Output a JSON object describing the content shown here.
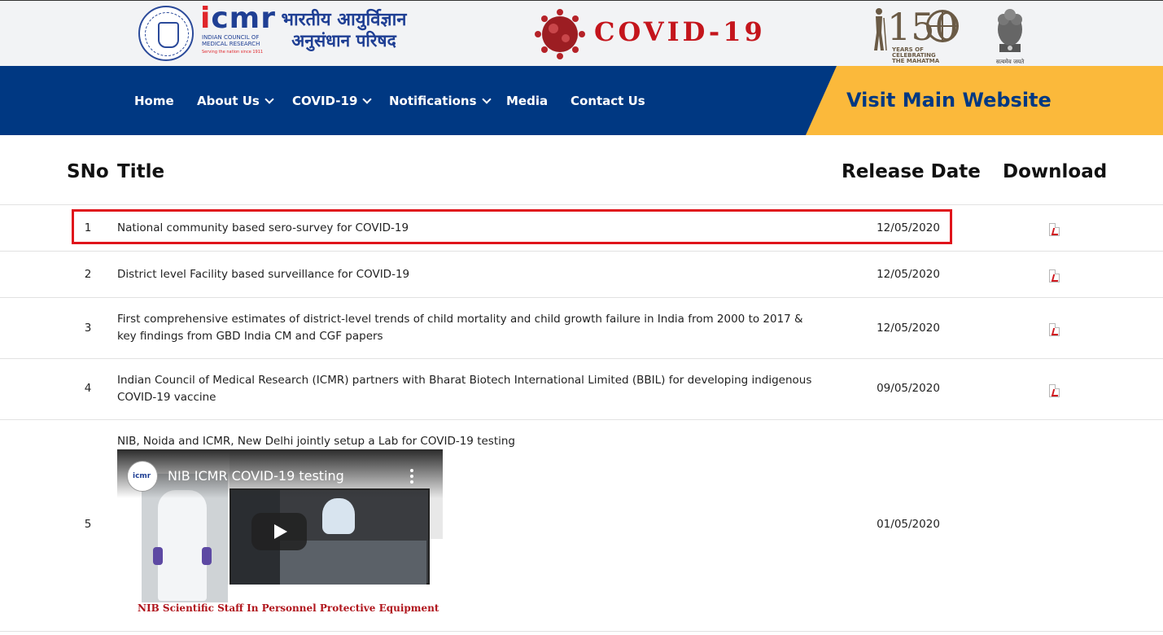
{
  "header": {
    "icmr_logo_text": "icmr",
    "icmr_full_name": "INDIAN COUNCIL OF MEDICAL RESEARCH",
    "icmr_tagline": "Serving the nation since 1911",
    "hindi_line1": "भारतीय आयुर्विज्ञान",
    "hindi_line2": "अनुसंधान परिषद",
    "covid_title": "COVID-19",
    "logo150_number": "150",
    "logo150_caption_lines": [
      "YEARS OF",
      "CELEBRATING",
      "THE MAHATMA"
    ],
    "emblem_caption": "सत्यमेव जयते"
  },
  "nav": {
    "items": [
      {
        "label": "Home",
        "dropdown": false
      },
      {
        "label": "About Us",
        "dropdown": true
      },
      {
        "label": "COVID-19",
        "dropdown": true
      },
      {
        "label": "Notifications",
        "dropdown": true
      },
      {
        "label": "Media",
        "dropdown": false
      },
      {
        "label": "Contact Us",
        "dropdown": false
      }
    ],
    "visit_label": "Visit Main Website"
  },
  "table": {
    "headers": {
      "sno": "SNo",
      "title": "Title",
      "release_date": "Release Date",
      "download": "Download"
    },
    "rows": [
      {
        "sno": "1",
        "title": "National community based sero-survey for COVID-19",
        "date": "12/05/2020",
        "has_pdf": true
      },
      {
        "sno": "2",
        "title": "District level Facility based surveillance for COVID-19",
        "date": "12/05/2020",
        "has_pdf": true
      },
      {
        "sno": "3",
        "title": "First comprehensive estimates of district-level trends of child mortality and child growth failure in India from 2000 to 2017 & key findings from GBD India CM and CGF papers",
        "date": "12/05/2020",
        "has_pdf": true
      },
      {
        "sno": "4",
        "title": "Indian Council of Medical Research (ICMR) partners with Bharat Biotech International Limited (BBIL) for developing indigenous COVID-19 vaccine",
        "date": "09/05/2020",
        "has_pdf": true
      },
      {
        "sno": "5",
        "title": "NIB, Noida and ICMR, New Delhi jointly setup a Lab for COVID-19 testing",
        "date": "01/05/2020",
        "has_pdf": false
      }
    ]
  },
  "video": {
    "channel_label": "icmr",
    "title": "NIB ICMR COVID-19 testing",
    "caption": "NIB Scientific Staff In Personnel Protective Equipment"
  },
  "colors": {
    "nav_bg": "#003882",
    "visit_bg": "#fbb93b",
    "highlight": "#e0141b",
    "covid_red": "#c4151c"
  }
}
